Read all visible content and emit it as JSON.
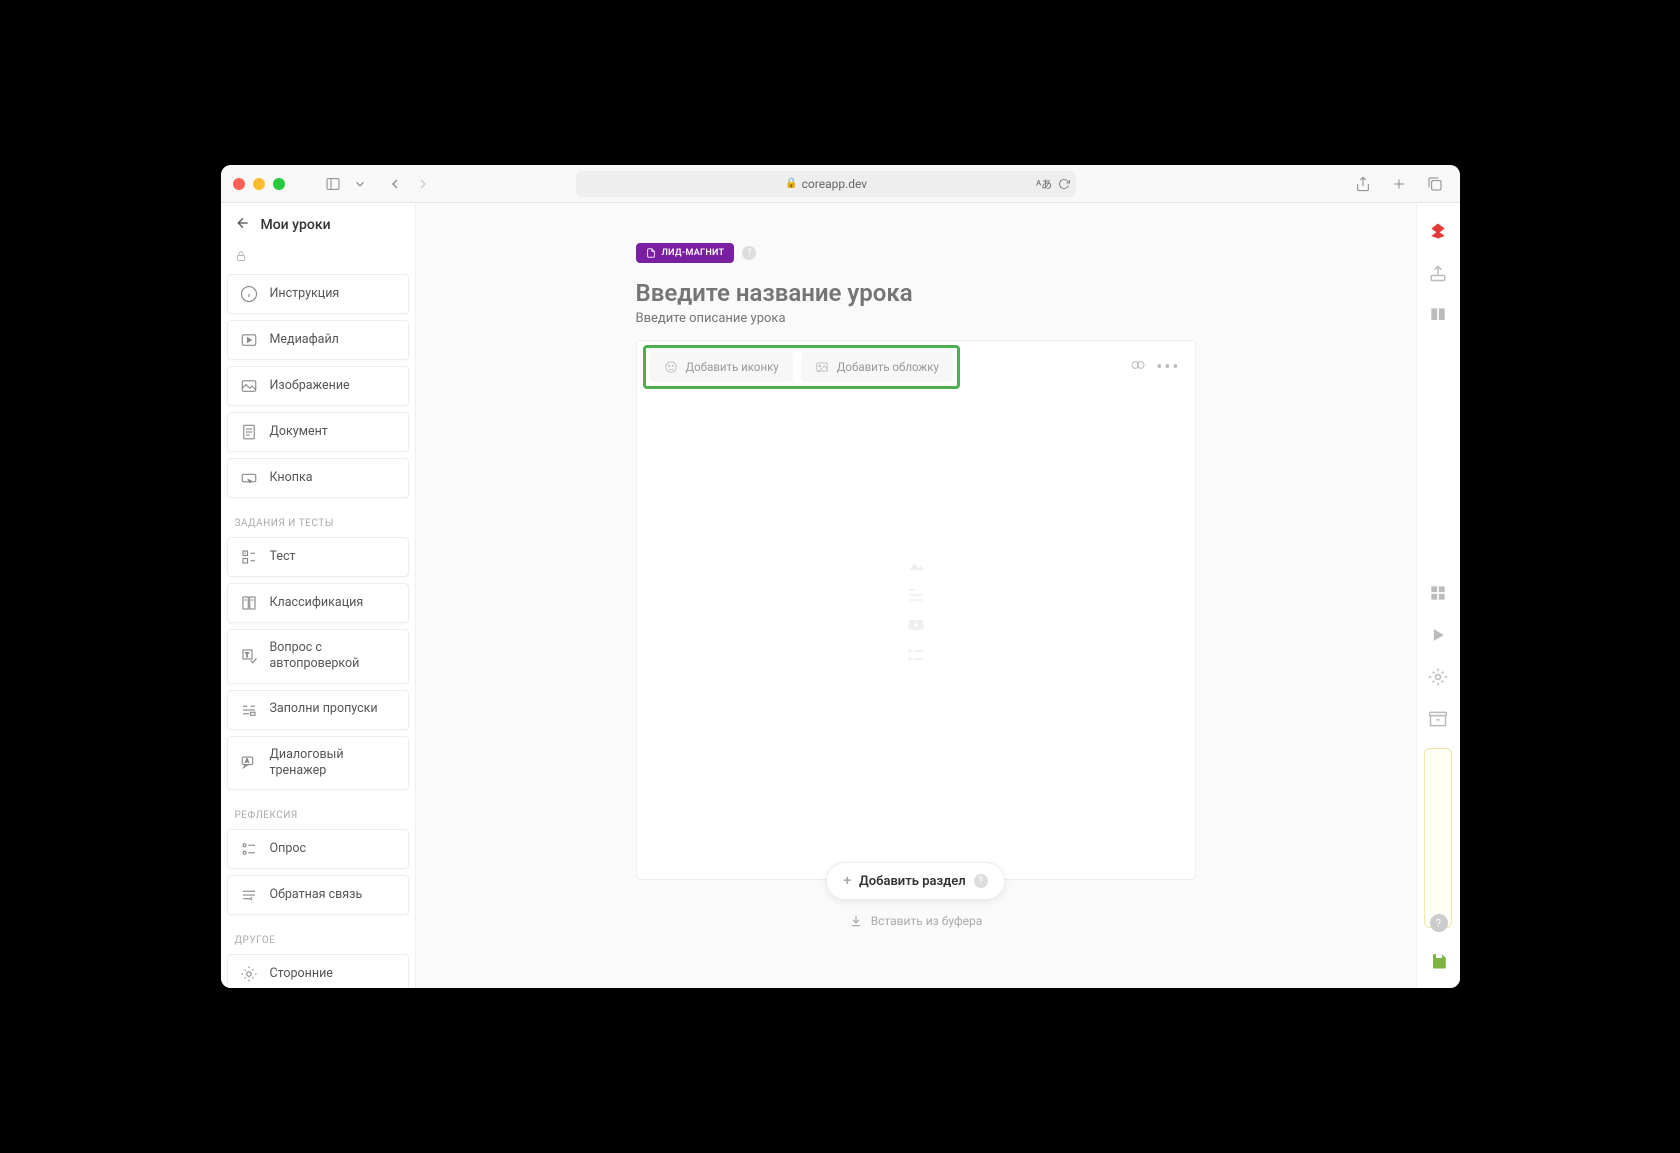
{
  "browser": {
    "url": "coreapp.dev"
  },
  "header": {
    "back_label": "Мои уроки"
  },
  "sidebar": {
    "sections": [
      {
        "items": [
          {
            "icon": "info",
            "label": "Инструкция"
          },
          {
            "icon": "play-box",
            "label": "Медиафайл"
          },
          {
            "icon": "image",
            "label": "Изображение"
          },
          {
            "icon": "document",
            "label": "Документ"
          },
          {
            "icon": "button",
            "label": "Кнопка"
          }
        ]
      },
      {
        "title": "ЗАДАНИЯ И ТЕСТЫ",
        "items": [
          {
            "icon": "test",
            "label": "Тест"
          },
          {
            "icon": "classification",
            "label": "Классификация"
          },
          {
            "icon": "autocheck",
            "label": "Вопрос с автопроверкой"
          },
          {
            "icon": "blanks",
            "label": "Заполни пропуски"
          },
          {
            "icon": "dialog",
            "label": "Диалоговый тренажер"
          }
        ]
      },
      {
        "title": "РЕФЛЕКСИЯ",
        "items": [
          {
            "icon": "survey",
            "label": "Опрос"
          },
          {
            "icon": "feedback",
            "label": "Обратная связь"
          }
        ]
      },
      {
        "title": "ДРУГОЕ",
        "items": [
          {
            "icon": "external",
            "label": "Сторонние"
          }
        ]
      }
    ]
  },
  "main": {
    "tag_label": "ЛИД-МАГНИТ",
    "title_placeholder": "Введите название урока",
    "desc_placeholder": "Введите описание урока",
    "add_icon_label": "Добавить иконку",
    "add_cover_label": "Добавить обложку",
    "add_section_label": "Добавить раздел",
    "paste_label": "Вставить из буфера"
  }
}
